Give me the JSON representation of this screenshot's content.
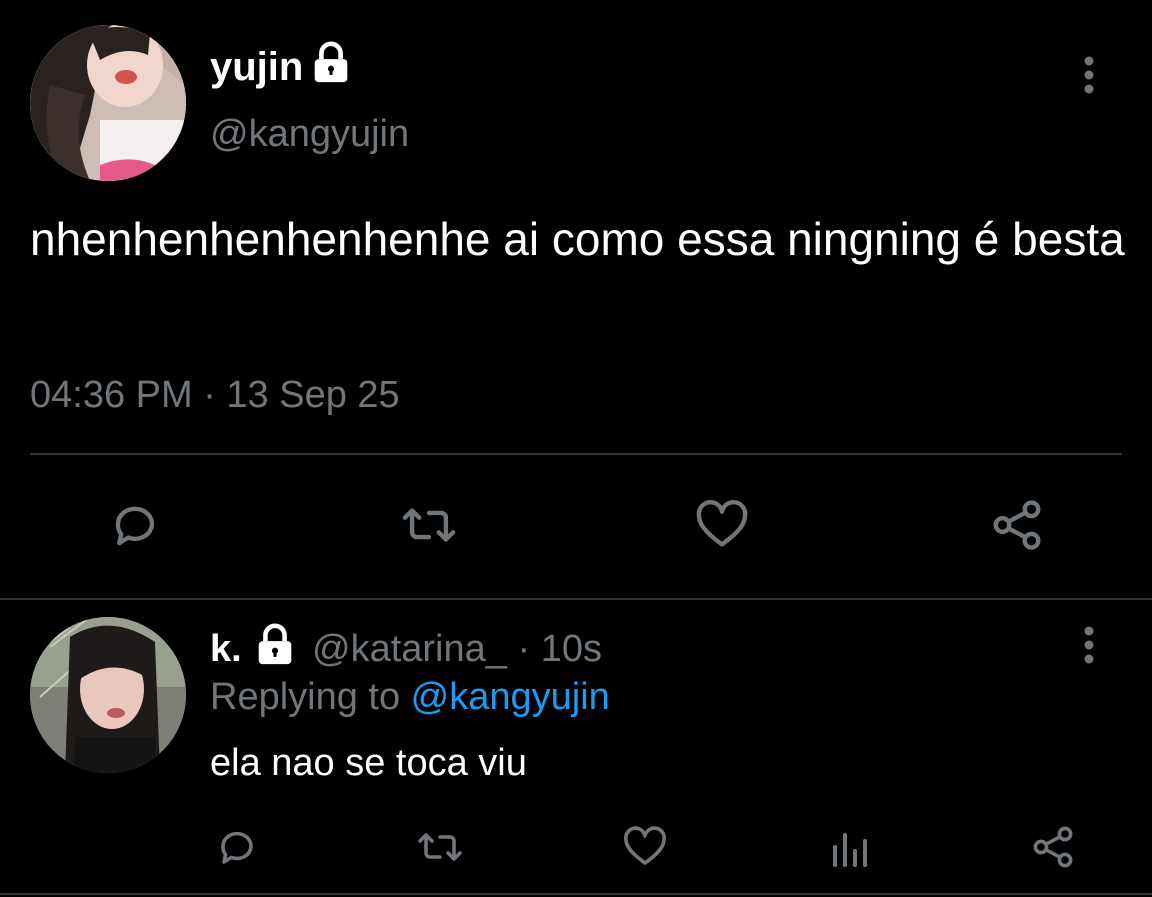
{
  "main_tweet": {
    "display_name": "yujin",
    "handle": "@kangyujin",
    "protected_icon": "lock-icon",
    "text": "nhenhenhenhenhenhe ai como essa ningning é besta",
    "timestamp": "04:36 PM · 13 Sep 25",
    "actions": [
      "reply-icon",
      "retweet-icon",
      "like-icon",
      "share-icon"
    ]
  },
  "reply_tweet": {
    "display_name": "k.",
    "protected_icon": "lock-icon",
    "handle": "@katarina_",
    "separator": " · ",
    "time_ago": "10s",
    "replying_prefix": "Replying to ",
    "replying_handle": "@kangyujin",
    "text": "ela nao se toca viu",
    "actions": [
      "reply-icon",
      "retweet-icon",
      "like-icon",
      "analytics-icon",
      "share-icon"
    ]
  },
  "colors": {
    "background": "#000000",
    "text_primary": "#ffffff",
    "text_secondary": "#71767b",
    "link": "#1d9bf0",
    "divider": "#2f3336"
  }
}
